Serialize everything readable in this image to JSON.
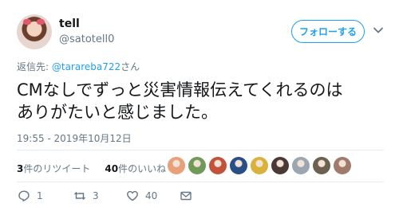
{
  "author": {
    "name": "tell",
    "handle": "@satotell0"
  },
  "follow_label": "フォローする",
  "reply_to": {
    "prefix": "返信先: ",
    "mention": "@tarareba722",
    "suffix": "さん"
  },
  "tweet": {
    "line1": "CMなしでずっと災害情報伝えてくれるのは",
    "line2": "ありがたいと感じました。"
  },
  "timestamp": "19:55 - 2019年10月12日",
  "stats": {
    "retweets_count": "3",
    "retweets_label": "件のリツイート",
    "likes_count": "40",
    "likes_label": "件のいいね"
  },
  "likers": [
    {
      "icon": "liker-avatar",
      "color": "#e9a07a"
    },
    {
      "icon": "liker-avatar",
      "color": "#6f9a5a"
    },
    {
      "icon": "liker-avatar",
      "color": "#c2523a"
    },
    {
      "icon": "liker-avatar",
      "color": "#2a4f86"
    },
    {
      "icon": "liker-avatar",
      "color": "#d9b23a"
    },
    {
      "icon": "liker-avatar",
      "color": "#4a3a36"
    },
    {
      "icon": "liker-avatar",
      "color": "#9aa6b2"
    },
    {
      "icon": "liker-avatar",
      "color": "#6b6152"
    },
    {
      "icon": "liker-avatar",
      "color": "#a07b6b"
    }
  ],
  "actions": {
    "reply_count": "1",
    "retweet_count": "3",
    "like_count": "40"
  },
  "colors": {
    "accent": "#1da1f2",
    "muted": "#657786",
    "divider": "#e6ecf0"
  }
}
